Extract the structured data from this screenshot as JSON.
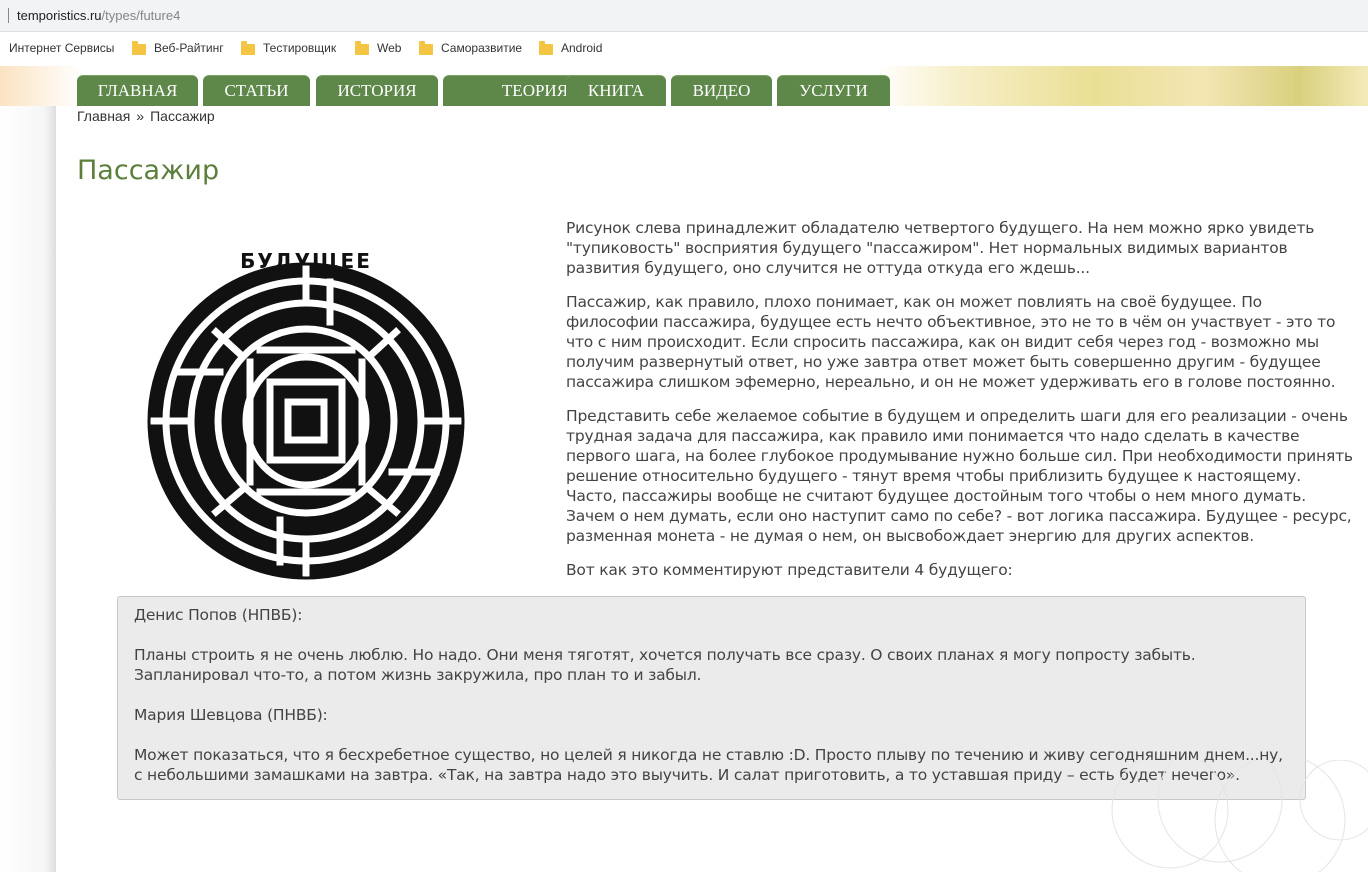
{
  "browser": {
    "url_host": "temporistics.ru",
    "url_path": "/types/future4"
  },
  "bookmarks": [
    {
      "label": "Интернет Сервисы",
      "icon": "none"
    },
    {
      "label": "Веб-Райтинг",
      "icon": "folder-icon"
    },
    {
      "label": "Тестировщик",
      "icon": "folder-icon"
    },
    {
      "label": "Web",
      "icon": "folder-icon"
    },
    {
      "label": "Саморазвитие",
      "icon": "folder-icon"
    },
    {
      "label": "Android",
      "icon": "folder-icon"
    }
  ],
  "nav": {
    "items": [
      {
        "label": "ГЛАВНАЯ"
      },
      {
        "label": "СТАТЬИ"
      },
      {
        "label": "ИСТОРИЯ"
      },
      {
        "label": "ТЕОРИЯ",
        "has_dropdown": true
      },
      {
        "label": "КНИГА"
      },
      {
        "label": "ВИДЕО"
      },
      {
        "label": "УСЛУГИ"
      }
    ],
    "color": "#5e874a"
  },
  "breadcrumb": {
    "home": "Главная",
    "separator": "»",
    "current": "Пассажир"
  },
  "page": {
    "title": "Пассажир",
    "title_color": "#5d7f3c",
    "image_caption": "БУДУЩЕЕ",
    "paragraphs": [
      "Рисунок слева принадлежит обладателю четвертого будущего. На нем можно ярко увидеть \"тупиковость\" восприятия будущего \"пассажиром\". Нет нормальных видимых вариантов развития будущего, оно случится не оттуда откуда его ждешь...",
      "Пассажир, как правило, плохо понимает, как он может повлиять на своё будущее. По философии пассажира, будущее есть нечто объективное, это не то в чём он участвует - это то что с ним происходит. Если спросить пассажира, как он видит себя через год - возможно мы получим развернутый ответ, но уже завтра ответ может быть совершенно другим - будущее пассажира слишком эфемерно, нереально, и он не может удерживать его в голове постоянно.",
      "Представить себе желаемое событие в будущем и определить шаги для его реализации - очень трудная задача для пассажира, как правило ими понимается что надо сделать в качестве первого шага, на более глубокое продумывание нужно больше сил. При необходимости принять решение относительно будущего - тянут время чтобы приблизить будущее к настоящему. Часто, пассажиры вообще не считают будущее достойным того чтобы о нем много думать. Зачем о нем думать, если оно наступит само по себе? - вот логика пассажира. Будущее - ресурс, разменная монета - не думая о нем, он высвобождает энергию для других аспектов.",
      "Вот как это комментируют представители 4 будущего:"
    ]
  },
  "comments": [
    {
      "author": "Денис Попов (НПВБ):",
      "text": "Планы строить я не очень люблю. Но надо. Они меня тяготят, хочется получать все сразу. О своих планах я могу попросту забыть. Запланировал что-то, а потом жизнь закружила, про план то и забыл."
    },
    {
      "author": "Мария Шевцова (ПНВБ):",
      "text": "Может показаться, что я бесхребетное существо, но целей я никогда не ставлю :D. Просто плыву по течению и живу сегодняшним днем...ну, с небольшими замашками на завтра. «Так, на завтра надо это выучить. И салат приготовить, а то уставшая приду – есть будет нечего»."
    }
  ]
}
